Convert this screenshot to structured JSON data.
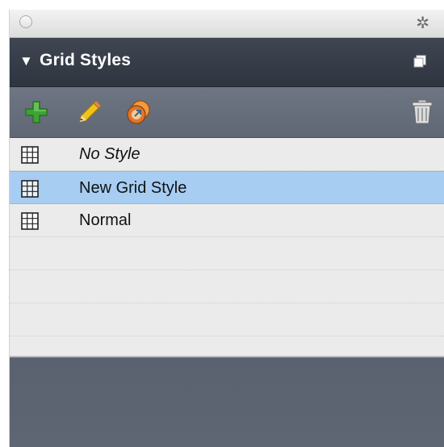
{
  "window": {
    "close_icon": "close-circle-icon",
    "gear_icon": "gear-icon"
  },
  "header": {
    "disclosure": "▼",
    "title": "Grid Styles",
    "menu_icon": "panel-menu-icon"
  },
  "toolbar": {
    "tools": [
      {
        "name": "new-style-button",
        "icon": "plus-icon",
        "color": "#3ea335"
      },
      {
        "name": "edit-style-button",
        "icon": "pencil-icon",
        "color": "#f2c21b"
      },
      {
        "name": "duplicate-style-button",
        "icon": "duplicate-icon",
        "color": "#e0752a"
      },
      {
        "name": "delete-style-button",
        "icon": "trash-icon",
        "color": "#d8d8d8"
      }
    ]
  },
  "styles": [
    {
      "label": "No Style",
      "italic": true,
      "selected": false
    },
    {
      "label": "New Grid Style",
      "italic": false,
      "selected": true
    },
    {
      "label": "Normal",
      "italic": false,
      "selected": false
    }
  ],
  "colors": {
    "selection": "#a7cdf3",
    "header_bg": "#353b46",
    "panel_bg": "#5e6673"
  }
}
